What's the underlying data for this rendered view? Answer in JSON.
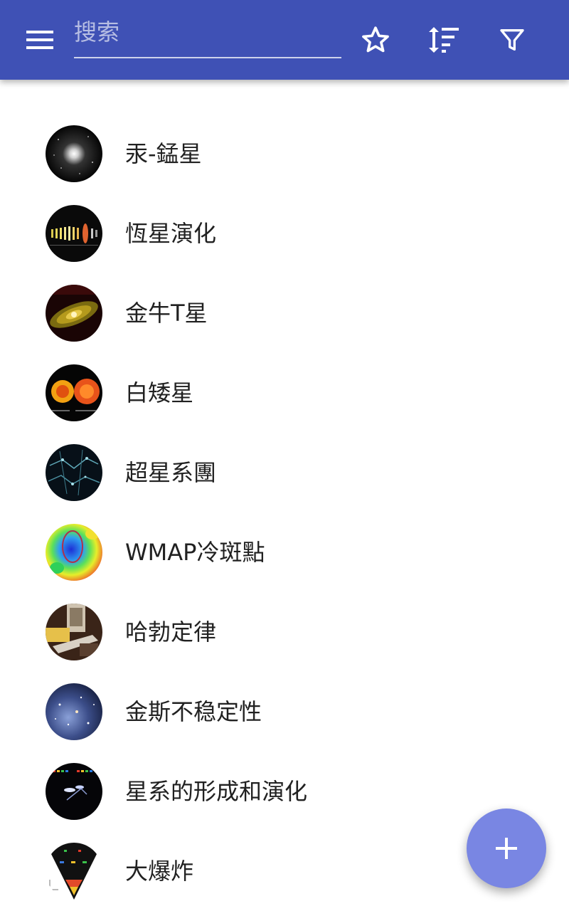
{
  "app_bar": {
    "search": {
      "placeholder": "搜索",
      "value": ""
    },
    "actions": [
      "menu-icon",
      "star-outline-icon",
      "sort-icon",
      "filter-icon"
    ],
    "color": "#3f51b5"
  },
  "list": {
    "items": [
      {
        "label": "汞-錳星"
      },
      {
        "label": "恆星演化"
      },
      {
        "label": "金牛T星"
      },
      {
        "label": "白矮星"
      },
      {
        "label": "超星系團"
      },
      {
        "label": "WMAP冷斑點"
      },
      {
        "label": "哈勃定律"
      },
      {
        "label": "金斯不稳定性"
      },
      {
        "label": "星系的形成和演化"
      },
      {
        "label": "大爆炸"
      }
    ]
  },
  "fab": {
    "icon": "plus-icon",
    "color": "#7986e3"
  }
}
